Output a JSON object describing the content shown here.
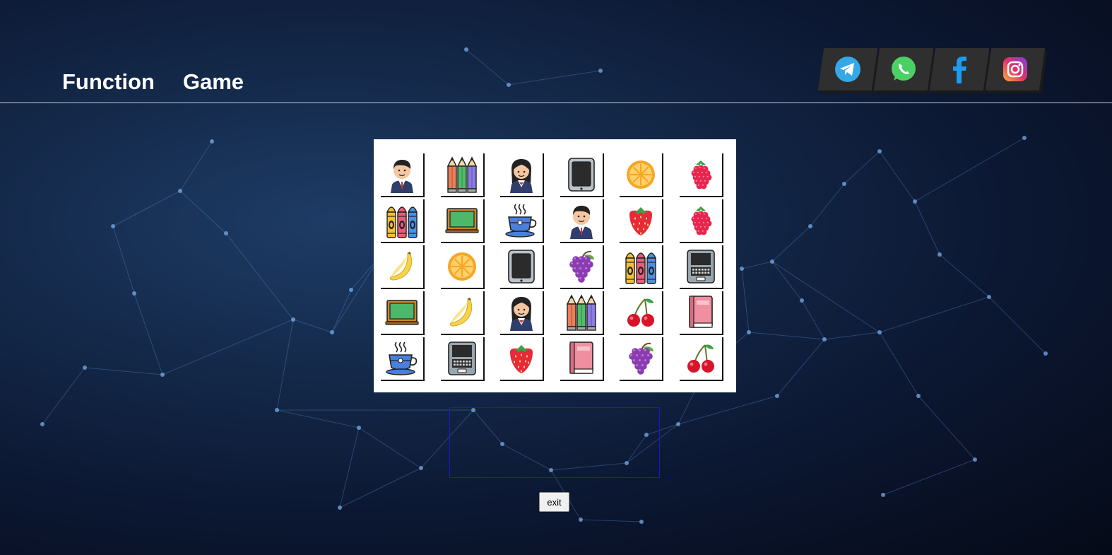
{
  "nav": {
    "items": [
      {
        "label": "Function"
      },
      {
        "label": "Game"
      }
    ]
  },
  "socials": [
    {
      "name": "telegram-icon",
      "color": "#35a9e8"
    },
    {
      "name": "whatsapp-icon",
      "color": "#4ad163"
    },
    {
      "name": "facebook-icon",
      "color": "#1d9bf0"
    },
    {
      "name": "instagram-icon",
      "color": "#c737b7"
    }
  ],
  "board": {
    "rows": 5,
    "cols": 6,
    "tiles": [
      [
        "boy",
        "pencils",
        "girl",
        "tablet",
        "orange",
        "raspberry"
      ],
      [
        "crayons",
        "blackboard",
        "coffee",
        "boy",
        "strawberry",
        "raspberry"
      ],
      [
        "banana",
        "orange",
        "tablet",
        "grapes",
        "crayons",
        "laptop"
      ],
      [
        "blackboard",
        "banana",
        "girl",
        "pencils",
        "cherries",
        "book"
      ],
      [
        "coffee",
        "laptop",
        "strawberry",
        "book",
        "grapes",
        "cherries"
      ]
    ]
  },
  "message": "",
  "exit_label": "exit"
}
